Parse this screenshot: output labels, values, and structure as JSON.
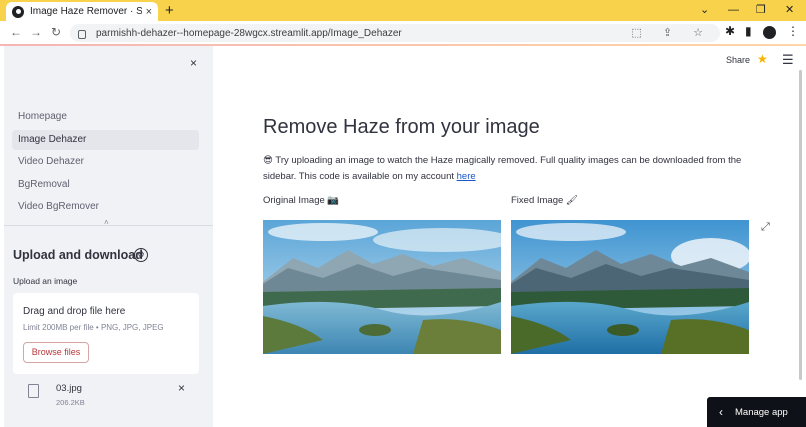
{
  "browser": {
    "tab_title": "Image Haze Remover · Streamlit",
    "tab_close": "×",
    "new_tab": "+",
    "url": "parmishh-dehazer--homepage-28wgcx.streamlit.app/Image_Dehazer",
    "controls": {
      "chevron": "⌄",
      "minimize": "—",
      "restore": "❐",
      "close": "✕"
    },
    "nav": {
      "back": "←",
      "forward": "→",
      "reload": "↻"
    },
    "omni_icons": "⬚ ⇪ ☆",
    "toolbar_icons": {
      "extensions": "✱",
      "sidebar": "▮",
      "menu": "⋮"
    }
  },
  "sidebar": {
    "close": "×",
    "nav_items": [
      {
        "label": "Homepage",
        "active": false
      },
      {
        "label": "Image Dehazer",
        "active": true
      },
      {
        "label": "Video Dehazer",
        "active": false
      },
      {
        "label": "BgRemoval",
        "active": false
      },
      {
        "label": "Video BgRemover",
        "active": false
      }
    ],
    "collapse": "˄",
    "heading": "Upload and download",
    "heading_icon": "⚙",
    "upload_label": "Upload an image",
    "dropzone": {
      "title": "Drag and drop file here",
      "subtitle": "Limit 200MB per file • PNG, JPG, JPEG",
      "button": "Browse files"
    },
    "file": {
      "name": "03.jpg",
      "size": "206.2KB",
      "remove": "×"
    }
  },
  "header": {
    "share": "Share",
    "star": "★",
    "menu": "☰"
  },
  "main": {
    "title": "Remove Haze from your image",
    "desc_emoji": "😎",
    "desc_text": "Try uploading an image to watch the Haze magically removed. Full quality images can be downloaded from the sidebar. This code is available on my account",
    "desc_link": "here",
    "original_caption": "Original Image 📷",
    "fixed_caption": "Fixed Image 🖌",
    "expand_icon": "⤢"
  },
  "footer": {
    "manage_app": "Manage app",
    "chevron": "‹"
  }
}
